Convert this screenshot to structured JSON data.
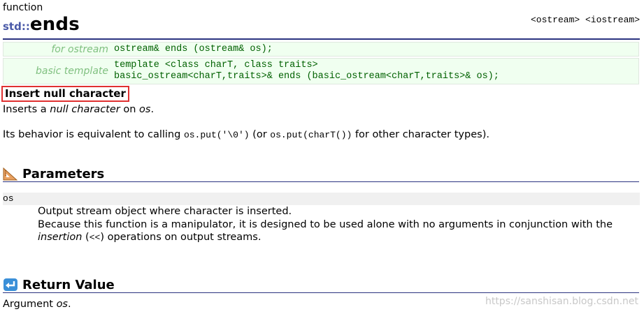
{
  "header": {
    "kind": "function",
    "namespace": "std::",
    "name": "ends",
    "headers": "<ostream> <iostream>"
  },
  "prototypes": [
    {
      "label": "for ostream",
      "lines": [
        "ostream& ends (ostream& os);"
      ]
    },
    {
      "label": "basic template",
      "lines": [
        "template <class charT, class traits>",
        "basic_ostream<charT,traits>& ends (basic_ostream<charT,traits>& os);"
      ]
    }
  ],
  "summary": "Insert null character",
  "description": {
    "line1_prefix": "Inserts a ",
    "line1_em": "null character",
    "line1_mid": " on ",
    "line1_em2": "os",
    "line1_end": ".",
    "line2_prefix": "Its behavior is equivalent to calling ",
    "line2_code1": "os.put('\\0')",
    "line2_mid": " (or ",
    "line2_code2": "os.put(charT())",
    "line2_end": " for other character types)."
  },
  "parameters": {
    "heading": "Parameters",
    "name": "os",
    "line1": "Output stream object where character is inserted.",
    "line2": "Because this function is a manipulator, it is designed to be used alone with no arguments in conjunction with the",
    "line3_em": "insertion",
    "line3_mid": " (",
    "line3_code": "<<",
    "line3_end": ") operations on output streams."
  },
  "return_value": {
    "heading": "Return Value",
    "text_prefix": "Argument ",
    "text_em": "os",
    "text_end": "."
  },
  "watermark": "https://sanshisan.blog.csdn.net",
  "colors": {
    "accent": "#2b3380",
    "highlight": "#e03030",
    "proto_bg": "#f0fff0"
  },
  "icons": {
    "parameters": "triangle-ruler-icon",
    "return": "return-arrow-icon"
  }
}
